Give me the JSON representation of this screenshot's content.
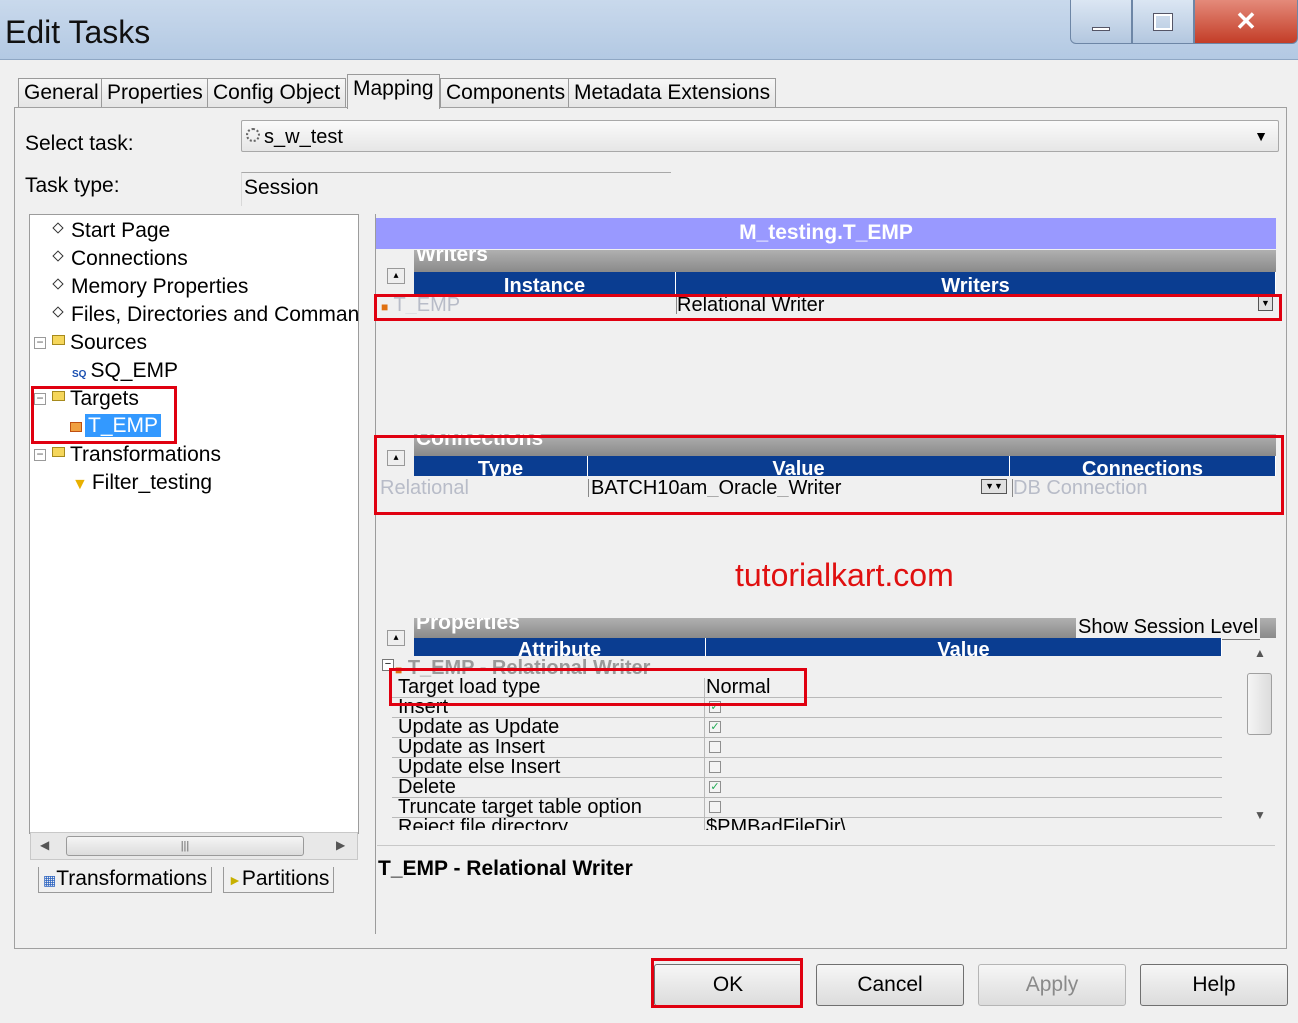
{
  "window": {
    "title": "Edit Tasks",
    "close_glyph": "✕"
  },
  "tabs": [
    "General",
    "Properties",
    "Config Object",
    "Mapping",
    "Components",
    "Metadata Extensions"
  ],
  "active_tab": "Mapping",
  "select_task": {
    "label": "Select task:",
    "value": "s_w_test"
  },
  "task_type": {
    "label": "Task type:",
    "value": "Session"
  },
  "tree": {
    "items": [
      {
        "label": "Start Page"
      },
      {
        "label": "Connections"
      },
      {
        "label": "Memory Properties"
      },
      {
        "label": "Files, Directories and Commands"
      },
      {
        "label": "Sources"
      },
      {
        "label": "SQ_EMP"
      },
      {
        "label": "Targets"
      },
      {
        "label": "T_EMP"
      },
      {
        "label": "Transformations"
      },
      {
        "label": "Filter_testing"
      }
    ],
    "expander_symbol": "−",
    "scroll_thumb": "|||",
    "sq_badge": "SQ"
  },
  "bottom_tabs": [
    "Transformations",
    "Partitions"
  ],
  "mapping_title": "M_testing.T_EMP",
  "writers": {
    "section": "Writers",
    "columns": [
      "Instance",
      "Writers"
    ],
    "row": {
      "instance": "T_EMP",
      "writer": "Relational Writer"
    }
  },
  "connections": {
    "section": "Connections",
    "columns": [
      "Type",
      "Value",
      "Connections"
    ],
    "row": {
      "type": "Relational",
      "value": "BATCH10am_Oracle_Writer",
      "connection": "DB Connection"
    }
  },
  "watermark": "tutorialkart.com",
  "properties": {
    "section": "Properties",
    "show_session_level": "Show Session Level",
    "columns": [
      "Attribute",
      "Value"
    ],
    "group": "T_EMP - Relational Writer",
    "rows": [
      {
        "attribute": "Target load type",
        "value": "Normal"
      },
      {
        "attribute": "Insert",
        "checked": true
      },
      {
        "attribute": "Update as Update",
        "checked": true
      },
      {
        "attribute": "Update as Insert",
        "checked": false
      },
      {
        "attribute": "Update else Insert",
        "checked": false
      },
      {
        "attribute": "Delete",
        "checked": true
      },
      {
        "attribute": "Truncate target table option",
        "checked": false
      },
      {
        "attribute": "Reject file directory",
        "value": "$PMBadFileDir\\"
      }
    ],
    "check_mark": "✓"
  },
  "description": "T_EMP - Relational Writer",
  "buttons": {
    "ok": "OK",
    "cancel": "Cancel",
    "apply": "Apply",
    "help": "Help"
  },
  "colors": {
    "header_blue": "#0a3d91",
    "mapping_title_bg": "#9999ff",
    "highlight_red": "#e00010",
    "selection": "#3399ff"
  }
}
